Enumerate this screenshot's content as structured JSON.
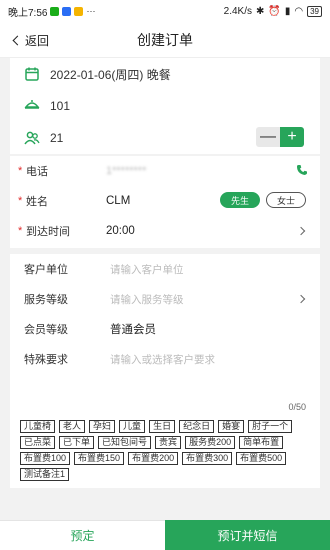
{
  "status": {
    "time": "晚上7:56",
    "speed": "2.4K/s",
    "battery": "39"
  },
  "nav": {
    "back_label": "返回",
    "title": "创建订单"
  },
  "booking": {
    "date": "2022-01-06(周四) 晚餐",
    "table": "101",
    "guests": "21"
  },
  "form": {
    "phone_label": "电话",
    "phone_value": "1********",
    "name_label": "姓名",
    "name_value": "CLM",
    "gender_male": "先生",
    "gender_female": "女士",
    "arrival_label": "到达时间",
    "arrival_value": "20:00"
  },
  "options": {
    "company_label": "客户单位",
    "company_placeholder": "请输入客户单位",
    "service_label": "服务等级",
    "service_placeholder": "请输入服务等级",
    "member_label": "会员等级",
    "member_value": "普通会员",
    "special_label": "特殊要求",
    "special_placeholder": "请输入或选择客户要求",
    "counter": "0/50"
  },
  "tags": [
    "儿童椅",
    "老人",
    "孕妇",
    "儿童",
    "生日",
    "纪念日",
    "婚宴",
    "肘子一个",
    "已点菜",
    "已下单",
    "已知包间号",
    "贵宾",
    "服务费200",
    "简单布置",
    "布置费100",
    "布置费150",
    "布置费200",
    "布置费300",
    "布置费500",
    "测试备注1"
  ],
  "actions": {
    "book": "预定",
    "book_sms": "预订并短信"
  },
  "colors": {
    "accent": "#27a55a",
    "required": "#e02b2b"
  }
}
